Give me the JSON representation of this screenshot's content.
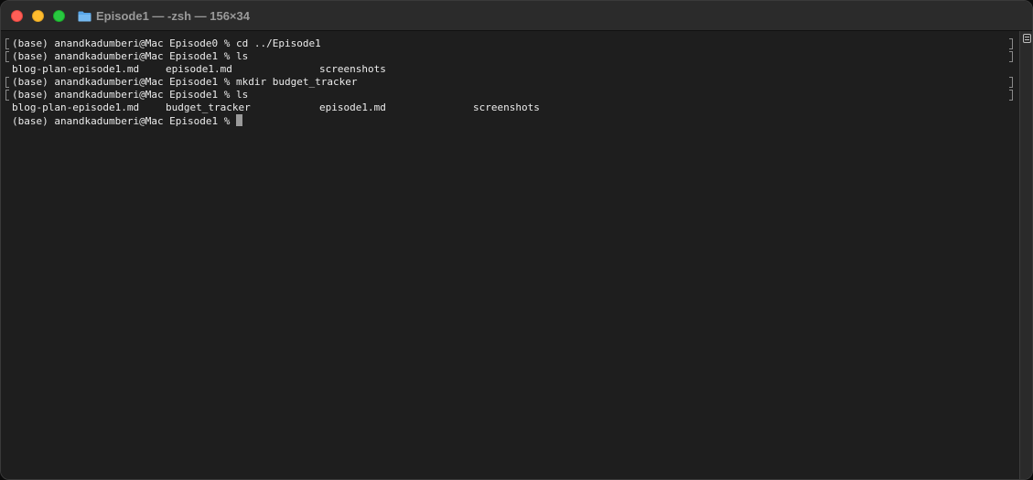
{
  "window": {
    "title": "Episode1 — -zsh — 156×34",
    "title_icon": "folder-icon",
    "accent_colors": {
      "close": "#ff5f57",
      "minimize": "#febc2e",
      "zoom": "#28c840",
      "folder": "#58a6e8"
    }
  },
  "terminal": {
    "lines": [
      {
        "text": "(base) anandkadumberi@Mac Episode0 % cd ../Episode1"
      },
      {
        "text": "(base) anandkadumberi@Mac Episode1 % ls"
      },
      {
        "cols": [
          "blog-plan-episode1.md",
          "episode1.md",
          "screenshots"
        ]
      },
      {
        "text": "(base) anandkadumberi@Mac Episode1 % mkdir budget_tracker"
      },
      {
        "text": "(base) anandkadumberi@Mac Episode1 % ls"
      },
      {
        "cols": [
          "blog-plan-episode1.md",
          "budget_tracker",
          "episode1.md",
          "screenshots"
        ]
      },
      {
        "text": "(base) anandkadumberi@Mac Episode1 % "
      }
    ]
  }
}
